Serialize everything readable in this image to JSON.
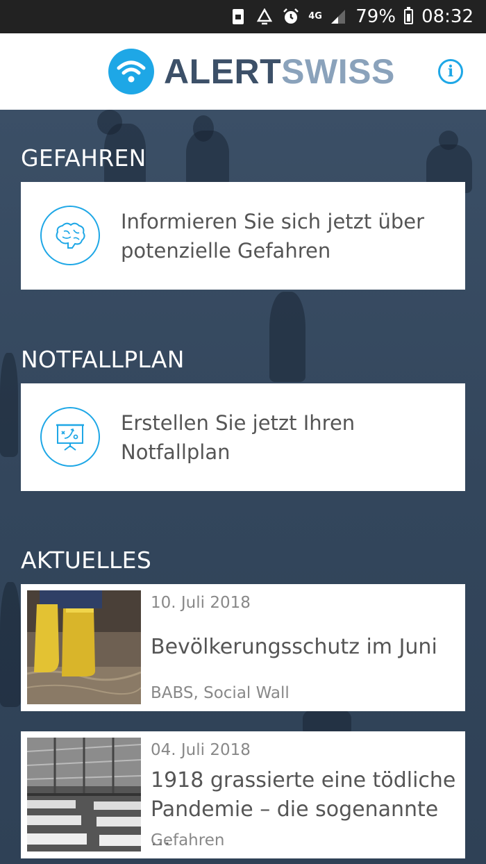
{
  "status_bar": {
    "battery_percent": "79%",
    "time": "08:32",
    "network": "4G",
    "icons": [
      "screenshot-icon",
      "recycle-icon",
      "alarm-icon",
      "signal-icon",
      "battery-icon"
    ]
  },
  "header": {
    "logo_part1": "ALERT",
    "logo_part2": "SWISS",
    "info_glyph": "i"
  },
  "colors": {
    "accent": "#1ea7e6",
    "logo_dark": "#3c5068",
    "logo_light": "#8aa2bb",
    "background": "#34475e"
  },
  "sections": {
    "gefahren": {
      "title": "GEFAHREN",
      "card_text": "Informieren Sie sich jetzt über potenzielle Gefahren",
      "icon": "brain-icon"
    },
    "notfallplan": {
      "title": "NOTFALLPLAN",
      "card_text": "Erstellen Sie jetzt Ihren Notfallplan",
      "icon": "strategy-board-icon"
    },
    "aktuelles": {
      "title": "AKTUELLES",
      "items": [
        {
          "date": "10. Juli 2018",
          "title": "Bevölkerungsschutz im Juni",
          "source": "BABS, Social Wall"
        },
        {
          "date": "04. Juli 2018",
          "title": "1918 grassierte eine tödliche Pandemie – die sogenannte ...",
          "source": "Gefahren"
        }
      ]
    }
  }
}
